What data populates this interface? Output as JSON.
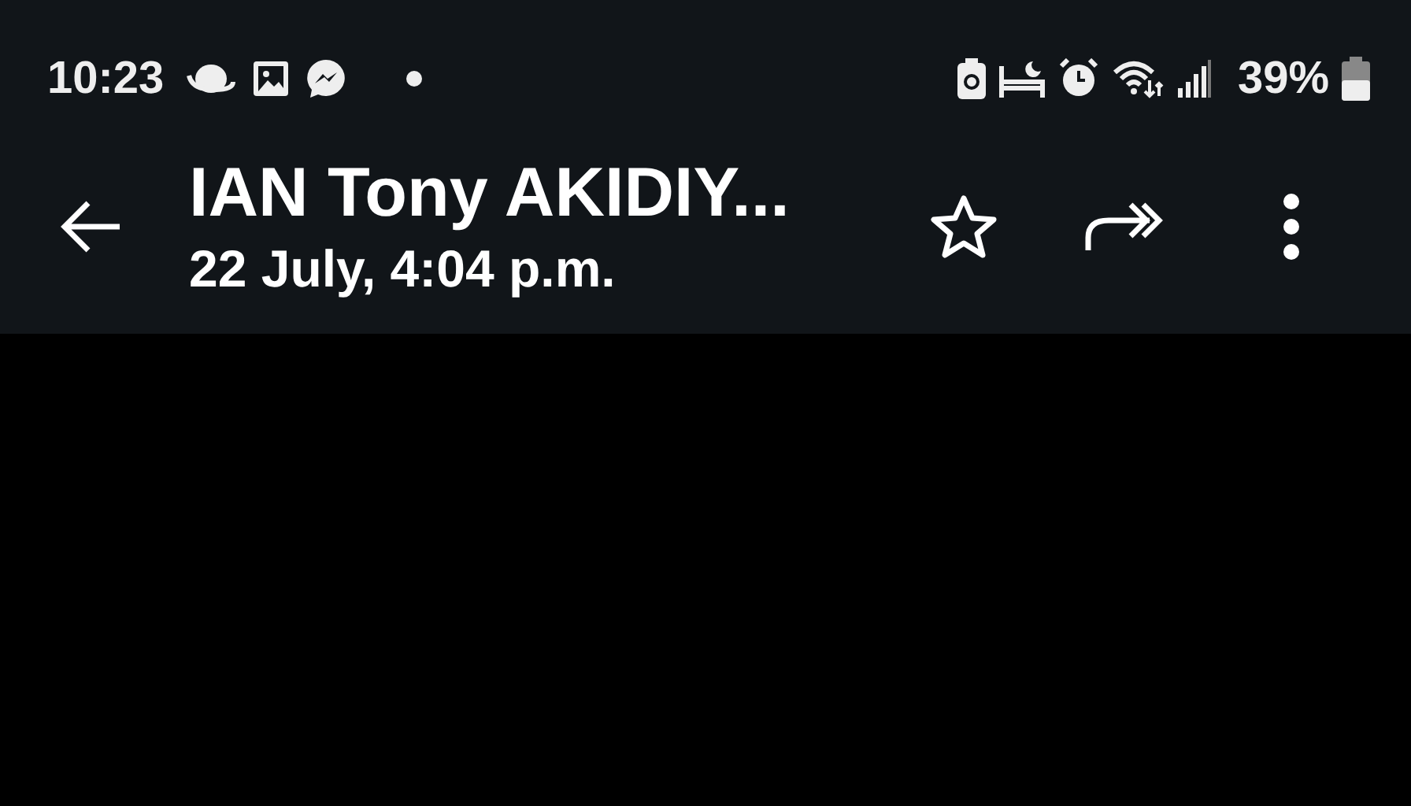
{
  "status_bar": {
    "time": "10:23",
    "battery_percent": "39%"
  },
  "header": {
    "title": "IAN Tony AKIDIY...",
    "subtitle": "22 July, 4:04 p.m."
  }
}
